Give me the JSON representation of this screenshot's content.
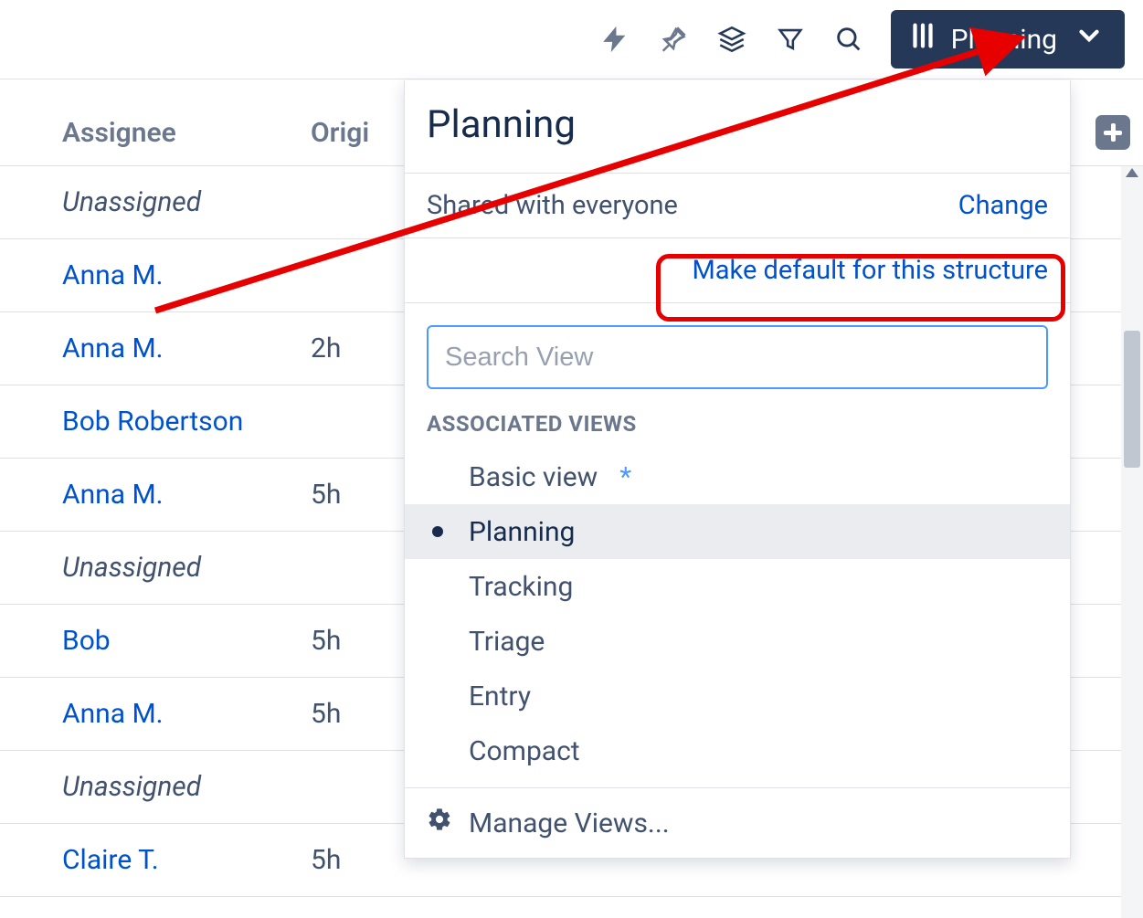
{
  "toolbar": {
    "view_label": "Planning"
  },
  "columns": {
    "assignee": "Assignee",
    "original": "Origi"
  },
  "rows": [
    {
      "assignee": "Unassigned",
      "type": "unassigned",
      "est": ""
    },
    {
      "assignee": "Anna M.",
      "type": "link",
      "est": ""
    },
    {
      "assignee": "Anna M.",
      "type": "link",
      "est": "2h"
    },
    {
      "assignee": "Bob Robertson",
      "type": "link",
      "est": ""
    },
    {
      "assignee": "Anna M.",
      "type": "link",
      "est": "5h"
    },
    {
      "assignee": "Unassigned",
      "type": "unassigned",
      "est": ""
    },
    {
      "assignee": "Bob",
      "type": "link",
      "est": "5h"
    },
    {
      "assignee": "Anna M.",
      "type": "link",
      "est": "5h"
    },
    {
      "assignee": "Unassigned",
      "type": "unassigned",
      "est": ""
    },
    {
      "assignee": "Claire T.",
      "type": "link",
      "est": "5h"
    }
  ],
  "panel": {
    "title": "Planning",
    "shared_text": "Shared with everyone",
    "change_link": "Change",
    "make_default": "Make default for this structure",
    "search_placeholder": "Search View",
    "section_label": "ASSOCIATED VIEWS",
    "views": [
      {
        "name": "Basic view",
        "selected": false,
        "starred": true
      },
      {
        "name": "Planning",
        "selected": true,
        "starred": false
      },
      {
        "name": "Tracking",
        "selected": false,
        "starred": false
      },
      {
        "name": "Triage",
        "selected": false,
        "starred": false
      },
      {
        "name": "Entry",
        "selected": false,
        "starred": false
      },
      {
        "name": "Compact",
        "selected": false,
        "starred": false
      }
    ],
    "manage_views": "Manage Views..."
  }
}
